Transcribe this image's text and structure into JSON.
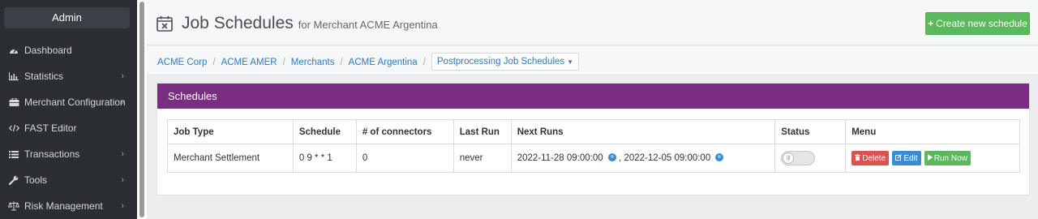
{
  "sidebar": {
    "admin_label": "Admin",
    "items": [
      {
        "label": "Dashboard",
        "icon": "tachometer-icon",
        "has_submenu": false
      },
      {
        "label": "Statistics",
        "icon": "bar-chart-icon",
        "has_submenu": true
      },
      {
        "label": "Merchant Configuration",
        "icon": "briefcase-icon",
        "has_submenu": true
      },
      {
        "label": "FAST Editor",
        "icon": "code-icon",
        "has_submenu": false
      },
      {
        "label": "Transactions",
        "icon": "list-icon",
        "has_submenu": true
      },
      {
        "label": "Tools",
        "icon": "wrench-icon",
        "has_submenu": true
      },
      {
        "label": "Risk Management",
        "icon": "balance-scale-icon",
        "has_submenu": true
      }
    ]
  },
  "header": {
    "title": "Job Schedules",
    "subtitle": "for Merchant ACME Argentina",
    "create_button": "Create new schedule"
  },
  "breadcrumb": {
    "items": [
      "ACME Corp",
      "ACME AMER",
      "Merchants",
      "ACME Argentina"
    ],
    "dropdown": "Postprocessing Job Schedules"
  },
  "panel": {
    "title": "Schedules",
    "table": {
      "columns": [
        "Job Type",
        "Schedule",
        "# of connectors",
        "Last Run",
        "Next Runs",
        "Status",
        "Menu"
      ],
      "rows": [
        {
          "job_type": "Merchant Settlement",
          "schedule": "0 9 * * 1",
          "connectors": "0",
          "last_run": "never",
          "next_run_1": "2022-11-28 09:00:00",
          "next_run_2": "2022-12-05 09:00:00",
          "status": "off",
          "actions": {
            "delete": "Delete",
            "edit": "Edit",
            "run": "Run Now"
          }
        }
      ]
    }
  },
  "colors": {
    "panel_header": "#7b2d81",
    "create_button": "#5cb85c",
    "delete_button": "#d9534f",
    "edit_button": "#3b8bd0",
    "run_button": "#5cb85c",
    "sidebar_bg": "#2b2e33"
  }
}
